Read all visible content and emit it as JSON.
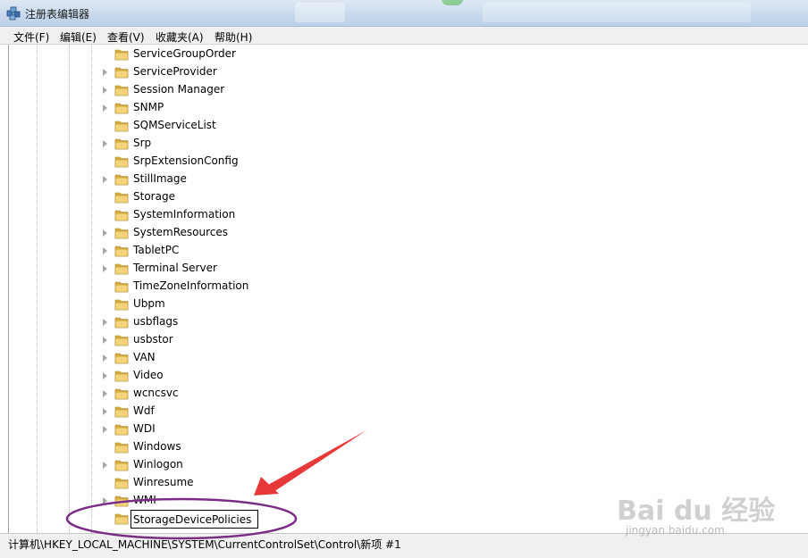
{
  "window": {
    "title": "注册表编辑器"
  },
  "menu": [
    {
      "label": "文件(F)"
    },
    {
      "label": "编辑(E)"
    },
    {
      "label": "查看(V)"
    },
    {
      "label": "收藏夹(A)"
    },
    {
      "label": "帮助(H)"
    }
  ],
  "tree": {
    "items": [
      {
        "label": "ServiceGroupOrder",
        "expandable": false
      },
      {
        "label": "ServiceProvider",
        "expandable": true
      },
      {
        "label": "Session Manager",
        "expandable": true
      },
      {
        "label": "SNMP",
        "expandable": true
      },
      {
        "label": "SQMServiceList",
        "expandable": false
      },
      {
        "label": "Srp",
        "expandable": true
      },
      {
        "label": "SrpExtensionConfig",
        "expandable": false
      },
      {
        "label": "StillImage",
        "expandable": true
      },
      {
        "label": "Storage",
        "expandable": false
      },
      {
        "label": "SystemInformation",
        "expandable": false
      },
      {
        "label": "SystemResources",
        "expandable": true
      },
      {
        "label": "TabletPC",
        "expandable": true
      },
      {
        "label": "Terminal Server",
        "expandable": true
      },
      {
        "label": "TimeZoneInformation",
        "expandable": false
      },
      {
        "label": "Ubpm",
        "expandable": false
      },
      {
        "label": "usbflags",
        "expandable": true
      },
      {
        "label": "usbstor",
        "expandable": true
      },
      {
        "label": "VAN",
        "expandable": true
      },
      {
        "label": "Video",
        "expandable": true
      },
      {
        "label": "wcncsvc",
        "expandable": true
      },
      {
        "label": "Wdf",
        "expandable": true
      },
      {
        "label": "WDI",
        "expandable": true
      },
      {
        "label": "Windows",
        "expandable": false
      },
      {
        "label": "Winlogon",
        "expandable": true
      },
      {
        "label": "Winresume",
        "expandable": false
      },
      {
        "label": "WMI",
        "expandable": true
      }
    ],
    "new_key": {
      "value": "StorageDevicePolicies"
    }
  },
  "status": {
    "path": "计算机\\HKEY_LOCAL_MACHINE\\SYSTEM\\CurrentControlSet\\Control\\新项 #1"
  },
  "watermark": {
    "text": "Bai du 经验",
    "url": "jingyan.baidu.com"
  },
  "colors": {
    "annotation_ellipse": "#7b2d86",
    "annotation_arrow": "#e8393a",
    "folder": "#e8c25a"
  },
  "icons": {
    "app": "registry-editor-icon",
    "folder": "folder-icon",
    "expander": "expand-triangle-icon"
  }
}
